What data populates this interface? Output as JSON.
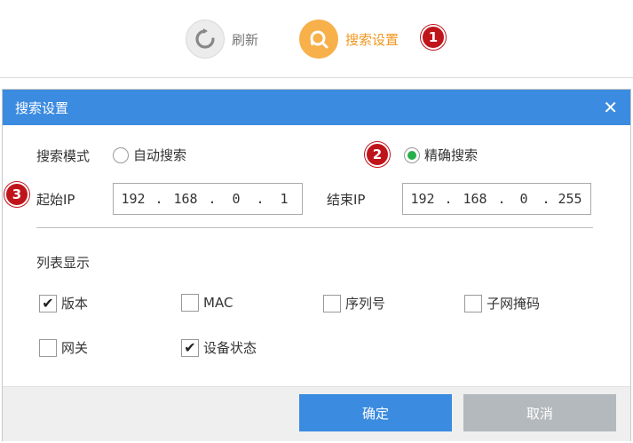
{
  "toolbar": {
    "refresh_label": "刷新",
    "search_settings_label": "搜索设置",
    "refresh_icon": "refresh-icon",
    "search_icon": "search-settings-icon"
  },
  "badges": [
    "1",
    "2",
    "3"
  ],
  "dialog": {
    "title": "搜索设置",
    "close_icon": "close-icon",
    "search_mode": {
      "label": "搜索模式",
      "options": [
        {
          "label": "自动搜索",
          "checked": false
        },
        {
          "label": "精确搜索",
          "checked": true
        }
      ]
    },
    "start_ip": {
      "label": "起始IP",
      "octets": [
        "192",
        "168",
        "0",
        "1"
      ]
    },
    "end_ip": {
      "label": "结束IP",
      "octets": [
        "192",
        "168",
        "0",
        "255"
      ]
    },
    "list_display": {
      "label": "列表显示",
      "items": [
        {
          "label": "版本",
          "checked": true
        },
        {
          "label": "MAC",
          "checked": false
        },
        {
          "label": "序列号",
          "checked": false
        },
        {
          "label": "子网掩码",
          "checked": false
        },
        {
          "label": "网关",
          "checked": false
        },
        {
          "label": "设备状态",
          "checked": true
        }
      ]
    },
    "buttons": {
      "ok": "确定",
      "cancel": "取消"
    }
  },
  "colors": {
    "header_blue": "#3b8be0",
    "accent_orange": "#f7b04a",
    "badge_red": "#c0141b",
    "radio_green": "#27b04a",
    "cancel_gray": "#b4b9be"
  }
}
